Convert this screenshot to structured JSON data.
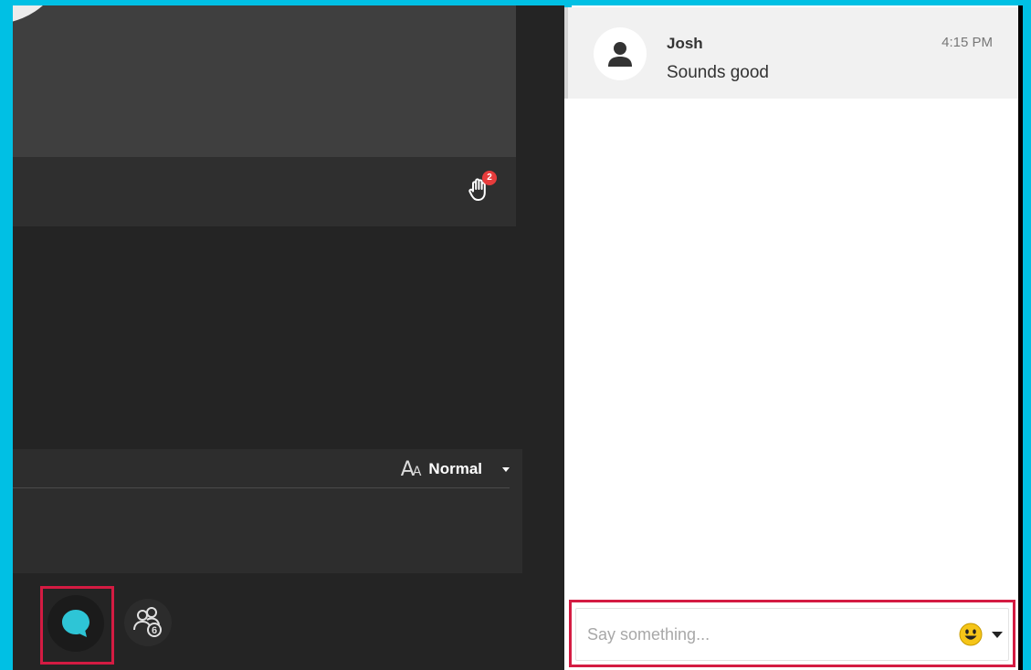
{
  "colors": {
    "frame_border": "#00c0e4",
    "highlight": "#d41b42",
    "chat_icon": "#2ec5d6",
    "badge": "#e73c3c"
  },
  "video": {
    "raise_hand_count": "2"
  },
  "captions": {
    "font_size_icon": "aa-icon",
    "font_size_value": "Normal"
  },
  "toolbar": {
    "chat_icon": "chat-bubble-icon",
    "participants_icon": "participants-icon",
    "participants_count": "6"
  },
  "chat": {
    "messages": [
      {
        "sender": "Josh",
        "time": "4:15 PM",
        "text": "Sounds good",
        "avatar_icon": "user-avatar-icon"
      }
    ],
    "input": {
      "value": "",
      "placeholder": "Say something..."
    },
    "emoji_icon": "smiley-emoji-icon"
  }
}
